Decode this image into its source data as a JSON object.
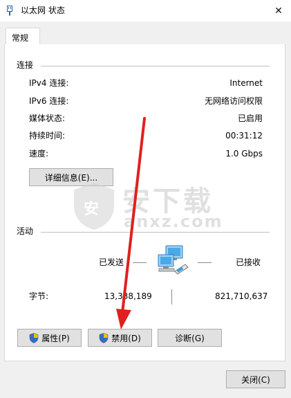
{
  "window": {
    "title": "以太网 状态",
    "close_glyph": "✕"
  },
  "tabs": [
    {
      "label": "常规"
    }
  ],
  "connection": {
    "heading": "连接",
    "rows": [
      {
        "key": "IPv4 连接:",
        "value": "Internet"
      },
      {
        "key": "IPv6 连接:",
        "value": "无网络访问权限"
      },
      {
        "key": "媒体状态:",
        "value": "已启用"
      },
      {
        "key": "持续时间:",
        "value": "00:31:12"
      },
      {
        "key": "速度:",
        "value": "1.0 Gbps"
      }
    ],
    "details_button": "详细信息(E)..."
  },
  "activity": {
    "heading": "活动",
    "sent_label": "已发送",
    "received_label": "已接收",
    "bytes_label": "字节:",
    "bytes_sent": "13,338,189",
    "bytes_received": "821,710,637"
  },
  "buttons": {
    "properties": "属性(P)",
    "disable": "禁用(D)",
    "diagnose": "诊断(G)",
    "close": "关闭(C)"
  },
  "watermark": {
    "cn": "安下载",
    "en": "anxz.com",
    "badge": "安"
  },
  "colors": {
    "arrow": "#e0201f",
    "shield_blue": "#2f6fc1",
    "shield_yellow": "#f2c200"
  }
}
